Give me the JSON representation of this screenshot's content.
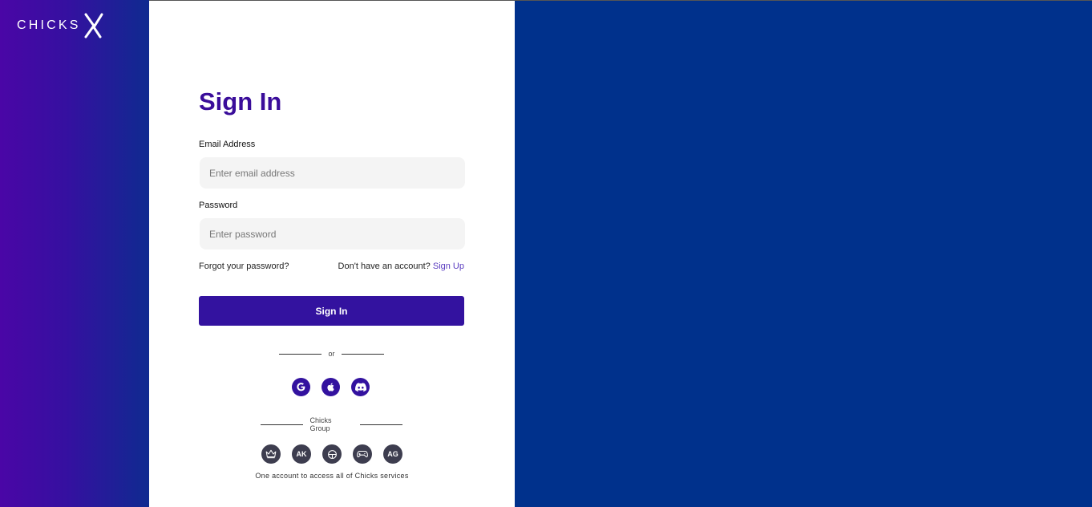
{
  "brand": {
    "logo_text": "CHICKS",
    "logo_mark": "X"
  },
  "form": {
    "title": "Sign In",
    "email_label": "Email Address",
    "email_placeholder": "Enter email address",
    "password_label": "Password",
    "password_placeholder": "Enter password",
    "forgot_label": "Forgot your password?",
    "no_account_text": "Don't have an account?",
    "signup_label": "Sign Up",
    "submit_label": "Sign In",
    "or_text": "or",
    "social": [
      {
        "name": "google",
        "icon": "google-icon"
      },
      {
        "name": "apple",
        "icon": "apple-icon"
      },
      {
        "name": "discord",
        "icon": "discord-icon"
      }
    ],
    "group_title": "Chicks Group",
    "group_services": [
      {
        "icon": "crown-icon"
      },
      {
        "icon": "ak-logo-icon",
        "text": "AK"
      },
      {
        "icon": "globe-icon"
      },
      {
        "icon": "gamepad-icon"
      },
      {
        "icon": "ag-logo-icon",
        "text": "AG"
      }
    ],
    "tagline": "One account to access all of Chicks services"
  },
  "colors": {
    "primary": "#33129f",
    "title": "#3a0d9a",
    "right_bg": "#00318c",
    "link": "#5a3cc0"
  }
}
